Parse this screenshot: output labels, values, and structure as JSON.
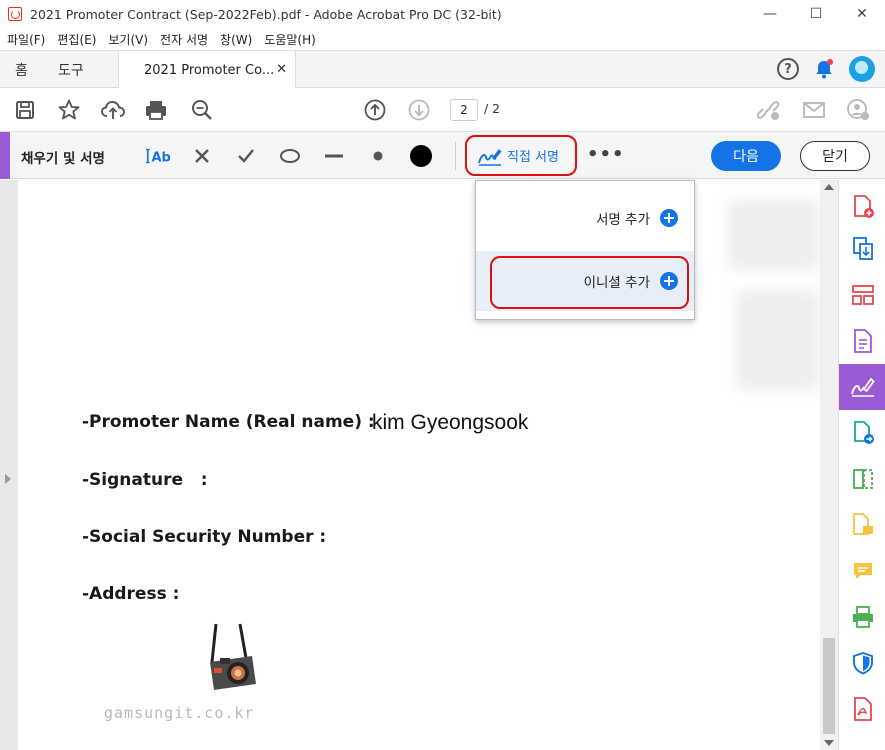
{
  "window": {
    "title": "2021 Promoter Contract (Sep-2022Feb).pdf - Adobe Acrobat Pro DC (32-bit)",
    "minimize": "—",
    "maximize": "☐",
    "close": "✕"
  },
  "menu": [
    "파일(F)",
    "편집(E)",
    "보기(V)",
    "전자 서명",
    "창(W)",
    "도움말(H)"
  ],
  "tabs": {
    "home": "홈",
    "tools": "도구",
    "document": "2021 Promoter Co...",
    "close": "✕"
  },
  "toolbar": {
    "page_current": "2",
    "page_total": "/ 2"
  },
  "signbar": {
    "title": "채우기 및 서명",
    "sign_label": "직접 서명",
    "more": "•••",
    "next_label": "다음",
    "close_label": "닫기"
  },
  "dropdown": {
    "add_signature": "서명 추가",
    "add_initials": "이니셜 추가"
  },
  "document": {
    "promoter_name_label": "-Promoter Name (Real name) :",
    "promoter_name_value": "kim Gyeongsook",
    "signature_label": "-Signature   :",
    "ssn_label": "-Social Security Number :",
    "address_label": "-Address :",
    "watermark": "gamsungit.co.kr"
  },
  "colors": {
    "accent_purple": "#9b5bd4",
    "primary_blue": "#1473e6",
    "highlight_red": "#e01010",
    "acrobat_red": "#d32f2f"
  }
}
